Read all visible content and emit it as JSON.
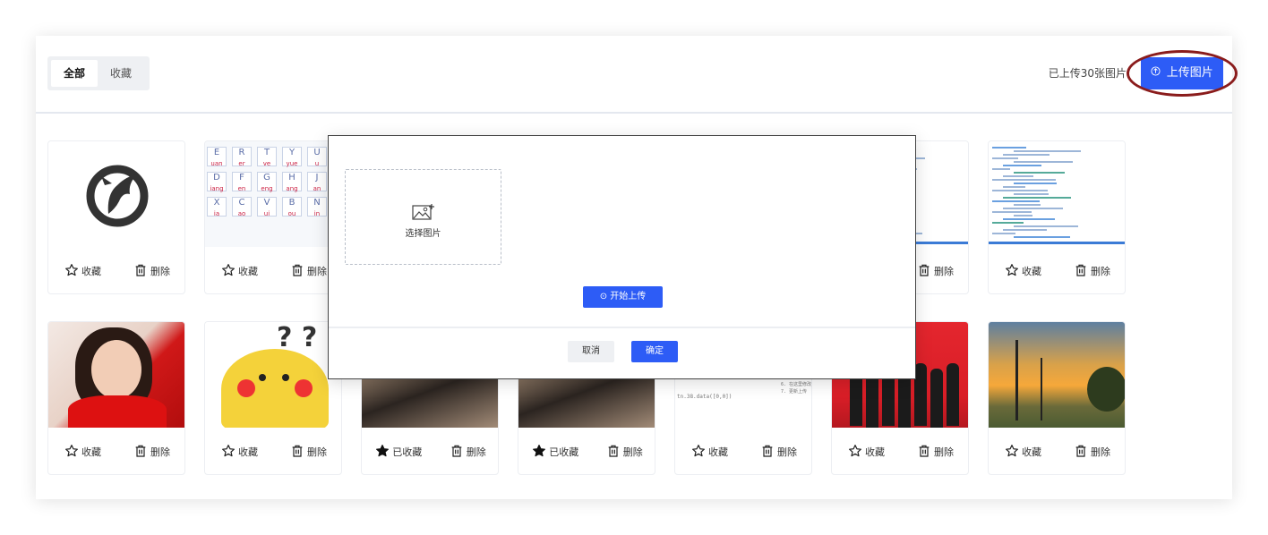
{
  "tabs": [
    {
      "label": "全部",
      "active": true
    },
    {
      "label": "收藏",
      "active": false
    }
  ],
  "upload_count": "已上传30张图片",
  "upload_button": {
    "label": "上传图片",
    "icon": "upload-circle-icon"
  },
  "actions": {
    "favorite": "收藏",
    "favorited": "已收藏",
    "delete": "删除"
  },
  "colors": {
    "primary": "#2d5cf6",
    "highlight_ring": "#8a1c1c"
  },
  "cards": [
    {
      "image": "logo",
      "favorited": false
    },
    {
      "image": "keyboard",
      "favorited": false
    },
    {
      "image": "hidden",
      "favorited": false
    },
    {
      "image": "hidden",
      "favorited": false
    },
    {
      "image": "hidden",
      "favorited": false
    },
    {
      "image": "code",
      "favorited": false
    },
    {
      "image": "code",
      "favorited": false
    },
    {
      "image": "portrait",
      "favorited": false
    },
    {
      "image": "pikachu",
      "favorited": false
    },
    {
      "image": "fur",
      "favorited": true
    },
    {
      "image": "fur",
      "favorited": true
    },
    {
      "image": "document",
      "favorited": false
    },
    {
      "image": "ceremony",
      "favorited": false
    },
    {
      "image": "sunset",
      "favorited": false
    }
  ],
  "keyboard_keys": [
    {
      "l": "E",
      "s": "uan"
    },
    {
      "l": "R",
      "s": "er"
    },
    {
      "l": "T",
      "s": "ve"
    },
    {
      "l": "Y",
      "s": "yue"
    },
    {
      "l": "U",
      "s": "u"
    },
    {
      "l": "D",
      "s": "iang"
    },
    {
      "l": "F",
      "s": "en"
    },
    {
      "l": "G",
      "s": "eng"
    },
    {
      "l": "H",
      "s": "ang"
    },
    {
      "l": "J",
      "s": "an"
    },
    {
      "l": "X",
      "s": "ia"
    },
    {
      "l": "C",
      "s": "ao"
    },
    {
      "l": "V",
      "s": "ui"
    },
    {
      "l": "B",
      "s": "ou"
    },
    {
      "l": "N",
      "s": "in"
    }
  ],
  "doc_text": {
    "line1": "tn.38.data([0,0])",
    "line2": "6. 在这里修改",
    "line3": "7. 更新上传"
  },
  "dialog": {
    "select_label": "选择图片",
    "select_icon": "image-add-icon",
    "start_upload": "开始上传",
    "cancel": "取消",
    "confirm": "确定"
  }
}
